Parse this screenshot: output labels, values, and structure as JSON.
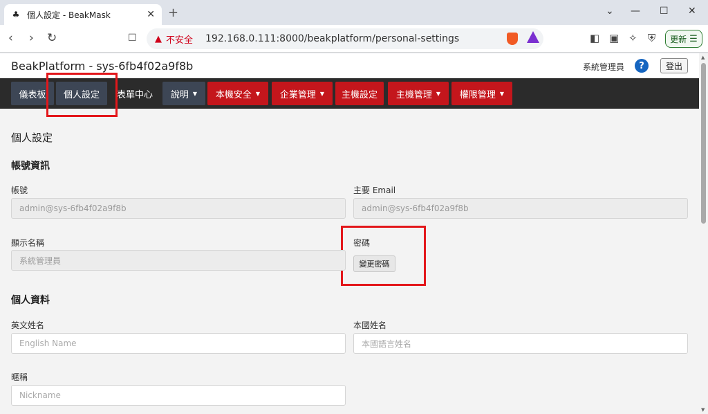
{
  "browser": {
    "tab_title": "個人設定 - BeakMask",
    "tab_close": "✕",
    "new_tab": "+",
    "security_label": "不安全",
    "url": "192.168.0.111:8000/beakplatform/personal-settings",
    "update_label": "更新"
  },
  "header": {
    "brand": "BeakPlatform - sys-6fb4f02a9f8b",
    "username": "系統管理員",
    "help": "?",
    "logout": "登出"
  },
  "nav": {
    "items": [
      {
        "label": "儀表板"
      },
      {
        "label": "個人設定"
      },
      {
        "label": "表單中心"
      },
      {
        "label": "說明"
      },
      {
        "label": "本機安全"
      },
      {
        "label": "企業管理"
      },
      {
        "label": "主機設定"
      },
      {
        "label": "主機管理"
      },
      {
        "label": "權限管理"
      }
    ]
  },
  "main": {
    "page_title": "個人設定",
    "account_section": "帳號資訊",
    "account_label": "帳號",
    "account_value": "admin@sys-6fb4f02a9f8b",
    "email_label": "主要 Email",
    "email_value": "admin@sys-6fb4f02a9f8b",
    "display_name_label": "顯示名稱",
    "display_name_value": "系統管理員",
    "password_label": "密碼",
    "change_password": "變更密碼",
    "profile_section": "個人資料",
    "english_name_label": "英文姓名",
    "english_name_placeholder": "English Name",
    "native_name_label": "本國姓名",
    "native_name_placeholder": "本國語言姓名",
    "nickname_label": "暱稱",
    "nickname_placeholder": "Nickname"
  },
  "colors": {
    "nav_dark": "#3d4655",
    "nav_red": "#c4161c",
    "highlight": "#e3171b",
    "help_blue": "#1565c0"
  }
}
